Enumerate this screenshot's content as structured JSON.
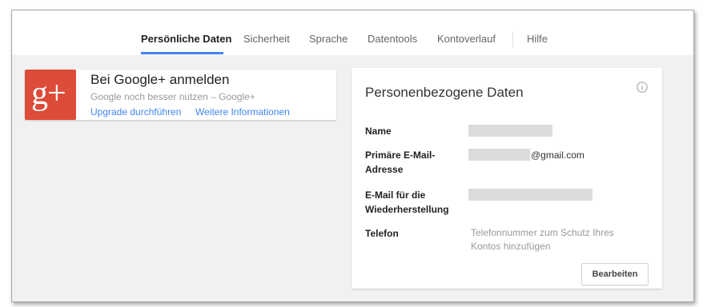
{
  "nav": {
    "tabs": [
      {
        "label": "Persönliche Daten",
        "active": true
      },
      {
        "label": "Sicherheit",
        "active": false
      },
      {
        "label": "Sprache",
        "active": false
      },
      {
        "label": "Datentools",
        "active": false
      },
      {
        "label": "Kontoverlauf",
        "active": false
      },
      {
        "label": "Hilfe",
        "active": false
      }
    ],
    "accent_color": "#4285f4"
  },
  "gplus": {
    "logo_text": "g+",
    "logo_color": "#dd4b39",
    "title": "Bei Google+ anmelden",
    "subtitle": "Google noch besser nutzen – Google+",
    "link_upgrade": "Upgrade durchführen",
    "link_more": "Weitere Informationen"
  },
  "personal": {
    "title": "Personenbezogene Daten",
    "info_icon": "info-icon",
    "name_label": "Name",
    "email_label": "Primäre E-Mail-Adresse",
    "email_suffix": "@gmail.com",
    "recovery_label": "E-Mail für die Wiederherstellung",
    "phone_label": "Telefon",
    "phone_hint": "Telefonnummer zum Schutz Ihres Kontos hinzufügen",
    "edit_button": "Bearbeiten"
  }
}
